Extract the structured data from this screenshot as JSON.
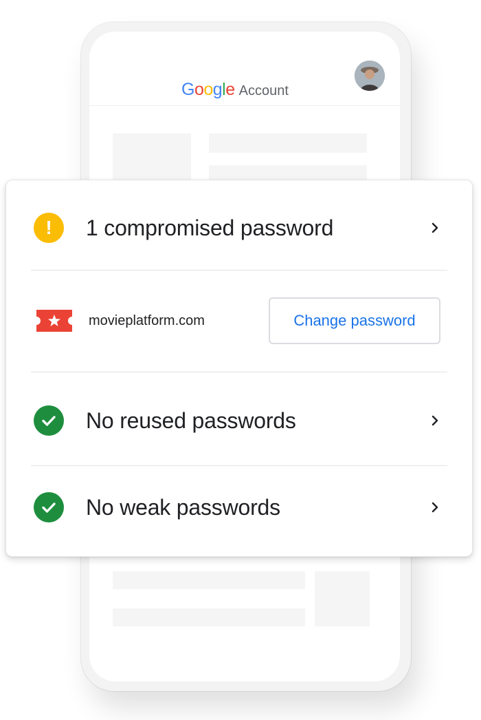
{
  "header": {
    "brand_letters": [
      "G",
      "o",
      "o",
      "g",
      "l",
      "e"
    ],
    "brand_colors": [
      "#4285F4",
      "#EA4335",
      "#FBBC05",
      "#4285F4",
      "#34A853",
      "#EA4335"
    ],
    "account_label": "Account"
  },
  "checkup": {
    "compromised": {
      "label": "1 compromised password",
      "icon": "warning-icon",
      "color": "#FBBC04"
    },
    "site": {
      "name": "movieplatform.com",
      "icon": "ticket-star-icon",
      "icon_color": "#EA4335",
      "button_label": "Change password",
      "button_color": "#1A73E8"
    },
    "reused": {
      "label": "No reused passwords",
      "icon": "check-circle-icon",
      "color": "#1E8E3E"
    },
    "weak": {
      "label": "No weak passwords",
      "icon": "check-circle-icon",
      "color": "#1E8E3E"
    }
  }
}
